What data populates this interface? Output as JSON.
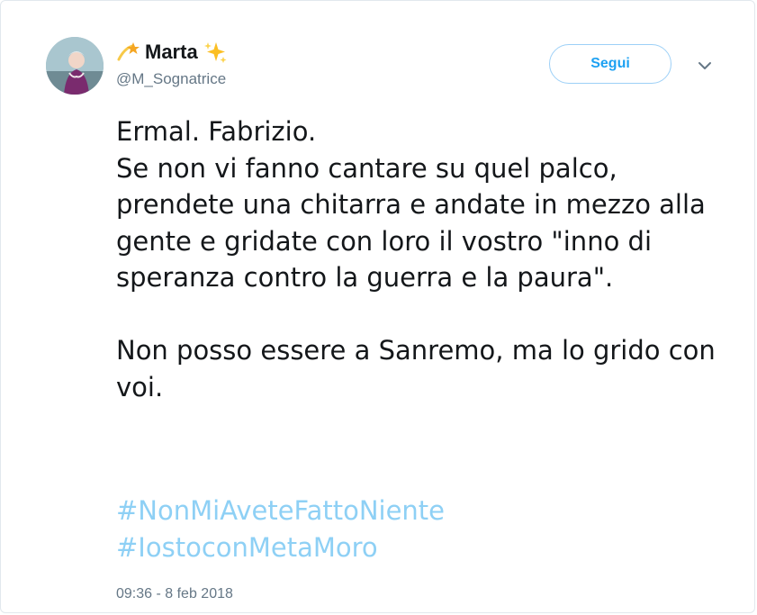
{
  "user": {
    "name": "Marta",
    "handle": "@M_Sognatrice",
    "name_prefix_icon": "shooting-star-icon",
    "name_suffix_icon": "sparkles-icon"
  },
  "actions": {
    "follow_label": "Segui",
    "more_icon": "chevron-down-icon"
  },
  "tweet": {
    "text": "Ermal. Fabrizio.\nSe non vi fanno cantare su quel palco, prendete una chitarra e andate in mezzo alla gente e gridate con loro il vostro \"inno di speranza contro la guerra e la paura\".\n\nNon posso essere a Sanremo, ma lo grido con voi.",
    "hashtags": [
      "#NonMiAveteFattoNiente",
      "#IostoconMetaMoro"
    ],
    "timestamp": "09:36 - 8 feb 2018"
  },
  "colors": {
    "link": "#8ed0f5",
    "follow_border": "#9dd0f7",
    "follow_text": "#1da1f2",
    "muted": "#657786"
  }
}
